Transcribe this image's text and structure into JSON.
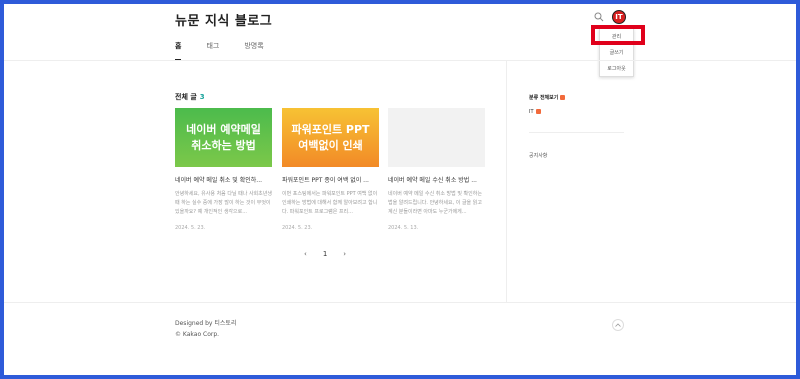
{
  "header": {
    "blog_title": "뉴문 지식 블로그",
    "nav": [
      {
        "label": "홈",
        "active": true
      },
      {
        "label": "태그",
        "active": false
      },
      {
        "label": "방명록",
        "active": false
      }
    ],
    "avatar_letter": "IT",
    "search_icon": "search-icon"
  },
  "dropdown": {
    "items": [
      "관리",
      "글쓰기",
      "로그아웃"
    ],
    "highlight_color": "#e0001b"
  },
  "main": {
    "section_title": "전체 글",
    "count": "3",
    "posts": [
      {
        "thumb_text_1": "네이버 예약메일",
        "thumb_text_2": "취소하는 방법",
        "title": "네이버 예약 메일 취소 및 확인하...",
        "excerpt": "안녕하세요, 유사용 처음 다닐 때나 사회초년생 때 하는 실수 중에 가장 많이 하는 것이 무엇이 있을까요? 예 개인적인 생각으로...",
        "date": "2024. 5. 23."
      },
      {
        "thumb_text_1": "파워포인트 PPT",
        "thumb_text_2": "여백없이 인쇄",
        "title": "파워포인트 PPT 종이 여백 없이 ...",
        "excerpt": "이번 포스팅에서는 파워포인트 PPT 여백 없이 인쇄하는 방법에 대해서 함께 알아보려고 합니다. 파워포인트 프로그램은 프리...",
        "date": "2024. 5. 23."
      },
      {
        "thumb_text_1": "",
        "thumb_text_2": "",
        "title": "네이버 예약 메일 수신 취소 방법 ...",
        "excerpt": "네이버 예약 메일 수신 취소 방법 및 확인하는 법을 알려드립니다. 안녕하세요, 이 글을 읽고 계신 분들이라면 아마도 누군가에게...",
        "date": "2024. 5. 13."
      }
    ],
    "pager": {
      "prev": "‹",
      "current": "1",
      "next": "›"
    }
  },
  "sidebar": {
    "category_title": "분류 전체보기",
    "category_item": "IT",
    "notice": "공지사항",
    "badge_color": "#f26a3b"
  },
  "footer": {
    "designed_by": "Designed by 티스토리",
    "copyright": "© Kakao Corp.",
    "top_icon": "chevron-up-icon"
  }
}
